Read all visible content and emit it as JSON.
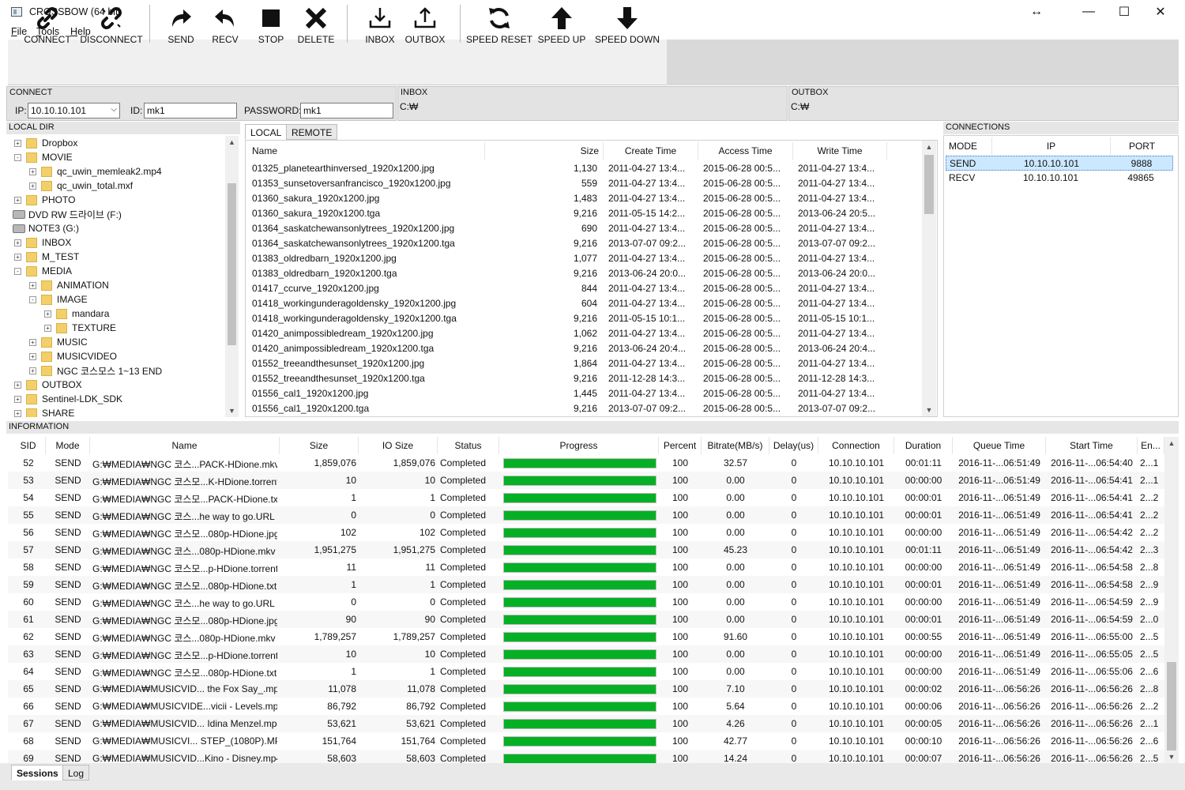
{
  "window": {
    "title": "CROSSBOW (64 bit)",
    "controls": [
      "↔",
      "—",
      "☐",
      "✕"
    ]
  },
  "menu": [
    {
      "key": "F",
      "rest": "ile"
    },
    {
      "key": "T",
      "rest": "ools"
    },
    {
      "key": "H",
      "rest": "elp"
    }
  ],
  "toolbar": {
    "connect": "CONNECT",
    "disconnect": "DISCONNECT",
    "send": "SEND",
    "recv": "RECV",
    "stop": "STOP",
    "delete": "DELETE",
    "inbox": "INBOX",
    "outbox": "OUTBOX",
    "speed_reset": "SPEED RESET",
    "speed_up": "SPEED UP",
    "speed_down": "SPEED DOWN"
  },
  "connect_panel": {
    "title": "CONNECT",
    "ip_label": "IP:",
    "ip_value": "10.10.10.101",
    "id_label": "ID:",
    "id_value": "mk1",
    "password_label": "PASSWORD:",
    "password_value": "mk1"
  },
  "inbox_panel": {
    "title": "INBOX",
    "path": "C:₩"
  },
  "outbox_panel": {
    "title": "OUTBOX",
    "path": "C:₩"
  },
  "local_dir": {
    "title": "LOCAL DIR",
    "items": [
      {
        "label": "Dropbox",
        "indent": 0,
        "icon": "folder",
        "exp": "+"
      },
      {
        "label": "MOVIE",
        "indent": 0,
        "icon": "folder",
        "exp": "-"
      },
      {
        "label": "qc_uwin_memleak2.mp4",
        "indent": 1,
        "icon": "folder",
        "exp": "+"
      },
      {
        "label": "qc_uwin_total.mxf",
        "indent": 1,
        "icon": "folder",
        "exp": "+"
      },
      {
        "label": "PHOTO",
        "indent": 0,
        "icon": "folder",
        "exp": "+"
      },
      {
        "label": "DVD RW 드라이브 (F:)",
        "indent": -1,
        "icon": "drive",
        "exp": ""
      },
      {
        "label": "NOTE3 (G:)",
        "indent": -1,
        "icon": "drive",
        "exp": ""
      },
      {
        "label": "INBOX",
        "indent": 0,
        "icon": "folder",
        "exp": "+"
      },
      {
        "label": "M_TEST",
        "indent": 0,
        "icon": "folder",
        "exp": "+"
      },
      {
        "label": "MEDIA",
        "indent": 0,
        "icon": "folder",
        "exp": "-"
      },
      {
        "label": "ANIMATION",
        "indent": 1,
        "icon": "folder",
        "exp": "+"
      },
      {
        "label": "IMAGE",
        "indent": 1,
        "icon": "folder",
        "exp": "-"
      },
      {
        "label": "mandara",
        "indent": 2,
        "icon": "folder",
        "exp": "+"
      },
      {
        "label": "TEXTURE",
        "indent": 2,
        "icon": "folder",
        "exp": "+"
      },
      {
        "label": "MUSIC",
        "indent": 1,
        "icon": "folder",
        "exp": "+"
      },
      {
        "label": "MUSICVIDEO",
        "indent": 1,
        "icon": "folder",
        "exp": "+"
      },
      {
        "label": "NGC 코스모스 1~13 END",
        "indent": 1,
        "icon": "folder",
        "exp": "+"
      },
      {
        "label": "OUTBOX",
        "indent": 0,
        "icon": "folder",
        "exp": "+"
      },
      {
        "label": "Sentinel-LDK_SDK",
        "indent": 0,
        "icon": "folder",
        "exp": "+"
      },
      {
        "label": "SHARE",
        "indent": 0,
        "icon": "folder",
        "exp": "+"
      }
    ]
  },
  "file_tabs": [
    "LOCAL",
    "REMOTE"
  ],
  "file_list": {
    "headers": [
      "Name",
      "Size",
      "Create Time",
      "Access Time",
      "Write  Time"
    ],
    "rows": [
      [
        "01325_planetearthinversed_1920x1200.jpg",
        "1,130",
        "2011-04-27 13:4...",
        "2015-06-28 00:5...",
        "2011-04-27 13:4..."
      ],
      [
        "01353_sunsetoversanfrancisco_1920x1200.jpg",
        "559",
        "2011-04-27 13:4...",
        "2015-06-28 00:5...",
        "2011-04-27 13:4..."
      ],
      [
        "01360_sakura_1920x1200.jpg",
        "1,483",
        "2011-04-27 13:4...",
        "2015-06-28 00:5...",
        "2011-04-27 13:4..."
      ],
      [
        "01360_sakura_1920x1200.tga",
        "9,216",
        "2011-05-15 14:2...",
        "2015-06-28 00:5...",
        "2013-06-24 20:5..."
      ],
      [
        "01364_saskatchewansonlytrees_1920x1200.jpg",
        "690",
        "2011-04-27 13:4...",
        "2015-06-28 00:5...",
        "2011-04-27 13:4..."
      ],
      [
        "01364_saskatchewansonlytrees_1920x1200.tga",
        "9,216",
        "2013-07-07 09:2...",
        "2015-06-28 00:5...",
        "2013-07-07 09:2..."
      ],
      [
        "01383_oldredbarn_1920x1200.jpg",
        "1,077",
        "2011-04-27 13:4...",
        "2015-06-28 00:5...",
        "2011-04-27 13:4..."
      ],
      [
        "01383_oldredbarn_1920x1200.tga",
        "9,216",
        "2013-06-24 20:0...",
        "2015-06-28 00:5...",
        "2013-06-24 20:0..."
      ],
      [
        "01417_ccurve_1920x1200.jpg",
        "844",
        "2011-04-27 13:4...",
        "2015-06-28 00:5...",
        "2011-04-27 13:4..."
      ],
      [
        "01418_workingunderagoldensky_1920x1200.jpg",
        "604",
        "2011-04-27 13:4...",
        "2015-06-28 00:5...",
        "2011-04-27 13:4..."
      ],
      [
        "01418_workingunderagoldensky_1920x1200.tga",
        "9,216",
        "2011-05-15 10:1...",
        "2015-06-28 00:5...",
        "2011-05-15 10:1..."
      ],
      [
        "01420_animpossibledream_1920x1200.jpg",
        "1,062",
        "2011-04-27 13:4...",
        "2015-06-28 00:5...",
        "2011-04-27 13:4..."
      ],
      [
        "01420_animpossibledream_1920x1200.tga",
        "9,216",
        "2013-06-24 20:4...",
        "2015-06-28 00:5...",
        "2013-06-24 20:4..."
      ],
      [
        "01552_treeandthesunset_1920x1200.jpg",
        "1,864",
        "2011-04-27 13:4...",
        "2015-06-28 00:5...",
        "2011-04-27 13:4..."
      ],
      [
        "01552_treeandthesunset_1920x1200.tga",
        "9,216",
        "2011-12-28 14:3...",
        "2015-06-28 00:5...",
        "2011-12-28 14:3..."
      ],
      [
        "01556_cal1_1920x1200.jpg",
        "1,445",
        "2011-04-27 13:4...",
        "2015-06-28 00:5...",
        "2011-04-27 13:4..."
      ],
      [
        "01556_cal1_1920x1200.tga",
        "9,216",
        "2013-07-07 09:2...",
        "2015-06-28 00:5...",
        "2013-07-07 09:2..."
      ]
    ]
  },
  "connections": {
    "title": "CONNECTIONS",
    "headers": [
      "MODE",
      "IP",
      "PORT"
    ],
    "rows": [
      [
        "SEND",
        "10.10.10.101",
        "9888"
      ],
      [
        "RECV",
        "10.10.10.101",
        "49865"
      ]
    ]
  },
  "information": {
    "title": "INFORMATION",
    "headers": [
      "SID",
      "Mode",
      "Name",
      "Size",
      "IO Size",
      "Status",
      "Progress",
      "Percent",
      "Bitrate(MB/s)",
      "Delay(us)",
      "Connection",
      "Duration",
      "Queue Time",
      "Start Time",
      "En..."
    ],
    "rows": [
      [
        "52",
        "SEND",
        "G:₩MEDIA₩NGC 코스...PACK-HDione.mkv",
        "1,859,076",
        "1,859,076",
        "Completed",
        100,
        "100",
        "32.57",
        "0",
        "10.10.10.101",
        "00:01:11",
        "2016-11-...06:51:49",
        "2016-11-...06:54:40",
        "2...1"
      ],
      [
        "53",
        "SEND",
        "G:₩MEDIA₩NGC 코스모...K-HDione.torrent",
        "10",
        "10",
        "Completed",
        100,
        "100",
        "0.00",
        "0",
        "10.10.10.101",
        "00:00:00",
        "2016-11-...06:51:49",
        "2016-11-...06:54:41",
        "2...1"
      ],
      [
        "54",
        "SEND",
        "G:₩MEDIA₩NGC 코스모...PACK-HDione.txt",
        "1",
        "1",
        "Completed",
        100,
        "100",
        "0.00",
        "0",
        "10.10.10.101",
        "00:00:01",
        "2016-11-...06:51:49",
        "2016-11-...06:54:41",
        "2...2"
      ],
      [
        "55",
        "SEND",
        "G:₩MEDIA₩NGC 코스...he way to go.URL",
        "0",
        "0",
        "Completed",
        100,
        "100",
        "0.00",
        "0",
        "10.10.10.101",
        "00:00:01",
        "2016-11-...06:51:49",
        "2016-11-...06:54:41",
        "2...2"
      ],
      [
        "56",
        "SEND",
        "G:₩MEDIA₩NGC 코스모...080p-HDione.jpg",
        "102",
        "102",
        "Completed",
        100,
        "100",
        "0.00",
        "0",
        "10.10.10.101",
        "00:00:00",
        "2016-11-...06:51:49",
        "2016-11-...06:54:42",
        "2...2"
      ],
      [
        "57",
        "SEND",
        "G:₩MEDIA₩NGC 코스...080p-HDione.mkv",
        "1,951,275",
        "1,951,275",
        "Completed",
        100,
        "100",
        "45.23",
        "0",
        "10.10.10.101",
        "00:01:11",
        "2016-11-...06:51:49",
        "2016-11-...06:54:42",
        "2...3"
      ],
      [
        "58",
        "SEND",
        "G:₩MEDIA₩NGC 코스모...p-HDione.torrent",
        "11",
        "11",
        "Completed",
        100,
        "100",
        "0.00",
        "0",
        "10.10.10.101",
        "00:00:00",
        "2016-11-...06:51:49",
        "2016-11-...06:54:58",
        "2...8"
      ],
      [
        "59",
        "SEND",
        "G:₩MEDIA₩NGC 코스모...080p-HDione.txt",
        "1",
        "1",
        "Completed",
        100,
        "100",
        "0.00",
        "0",
        "10.10.10.101",
        "00:00:01",
        "2016-11-...06:51:49",
        "2016-11-...06:54:58",
        "2...9"
      ],
      [
        "60",
        "SEND",
        "G:₩MEDIA₩NGC 코스...he way to go.URL",
        "0",
        "0",
        "Completed",
        100,
        "100",
        "0.00",
        "0",
        "10.10.10.101",
        "00:00:00",
        "2016-11-...06:51:49",
        "2016-11-...06:54:59",
        "2...9"
      ],
      [
        "61",
        "SEND",
        "G:₩MEDIA₩NGC 코스모...080p-HDione.jpg",
        "90",
        "90",
        "Completed",
        100,
        "100",
        "0.00",
        "0",
        "10.10.10.101",
        "00:00:01",
        "2016-11-...06:51:49",
        "2016-11-...06:54:59",
        "2...0"
      ],
      [
        "62",
        "SEND",
        "G:₩MEDIA₩NGC 코스...080p-HDione.mkv",
        "1,789,257",
        "1,789,257",
        "Completed",
        100,
        "100",
        "91.60",
        "0",
        "10.10.10.101",
        "00:00:55",
        "2016-11-...06:51:49",
        "2016-11-...06:55:00",
        "2...5"
      ],
      [
        "63",
        "SEND",
        "G:₩MEDIA₩NGC 코스모...p-HDione.torrent",
        "10",
        "10",
        "Completed",
        100,
        "100",
        "0.00",
        "0",
        "10.10.10.101",
        "00:00:00",
        "2016-11-...06:51:49",
        "2016-11-...06:55:05",
        "2...5"
      ],
      [
        "64",
        "SEND",
        "G:₩MEDIA₩NGC 코스모...080p-HDione.txt",
        "1",
        "1",
        "Completed",
        100,
        "100",
        "0.00",
        "0",
        "10.10.10.101",
        "00:00:00",
        "2016-11-...06:51:49",
        "2016-11-...06:55:06",
        "2...6"
      ],
      [
        "65",
        "SEND",
        "G:₩MEDIA₩MUSICVID... the Fox Say_.mp4",
        "11,078",
        "11,078",
        "Completed",
        100,
        "100",
        "7.10",
        "0",
        "10.10.10.101",
        "00:00:02",
        "2016-11-...06:56:26",
        "2016-11-...06:56:26",
        "2...8"
      ],
      [
        "66",
        "SEND",
        "G:₩MEDIA₩MUSICVIDE...vicii - Levels.mp4",
        "86,792",
        "86,792",
        "Completed",
        100,
        "100",
        "5.64",
        "0",
        "10.10.10.101",
        "00:00:06",
        "2016-11-...06:56:26",
        "2016-11-...06:56:26",
        "2...2"
      ],
      [
        "67",
        "SEND",
        "G:₩MEDIA₩MUSICVID... Idina Menzel.mp4",
        "53,621",
        "53,621",
        "Completed",
        100,
        "100",
        "4.26",
        "0",
        "10.10.10.101",
        "00:00:05",
        "2016-11-...06:56:26",
        "2016-11-...06:56:26",
        "2...1"
      ],
      [
        "68",
        "SEND",
        "G:₩MEDIA₩MUSICVI... STEP_(1080P).MP4",
        "151,764",
        "151,764",
        "Completed",
        100,
        "100",
        "42.77",
        "0",
        "10.10.10.101",
        "00:00:10",
        "2016-11-...06:56:26",
        "2016-11-...06:56:26",
        "2...6"
      ],
      [
        "69",
        "SEND",
        "G:₩MEDIA₩MUSICVID...Kino - Disney.mp4",
        "58,603",
        "58,603",
        "Completed",
        100,
        "100",
        "14.24",
        "0",
        "10.10.10.101",
        "00:00:07",
        "2016-11-...06:56:26",
        "2016-11-...06:56:26",
        "2...5"
      ]
    ]
  },
  "bottom_tabs": [
    "Sessions",
    "Log"
  ],
  "colors": {
    "progress": "#06b025",
    "selected_row": "#cce8ff",
    "toolbar_bg": "#f0f0f0"
  }
}
